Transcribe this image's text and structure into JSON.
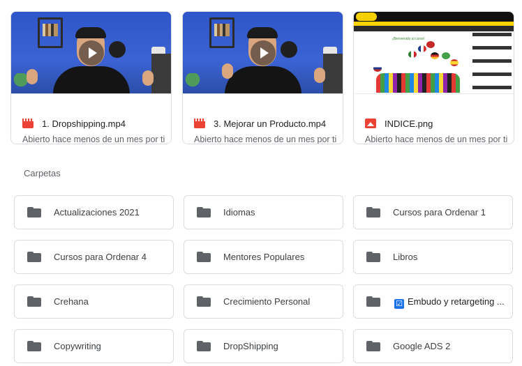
{
  "files": [
    {
      "name": "1. Dropshipping.mp4",
      "subtitle": "Abierto hace menos de un mes por ti",
      "type": "video",
      "icon": "video-file-icon"
    },
    {
      "name": "3. Mejorar un Producto.mp4",
      "subtitle": "Abierto hace menos de un mes por ti",
      "type": "video",
      "icon": "video-file-icon"
    },
    {
      "name": "INDICE.png",
      "subtitle": "Abierto hace menos de un mes por ti",
      "type": "image",
      "icon": "image-file-icon"
    }
  ],
  "folders_section": {
    "title": "Carpetas",
    "folders": [
      {
        "name": "Actualizaciones 2021"
      },
      {
        "name": "Idiomas"
      },
      {
        "name": "Cursos para Ordenar 1"
      },
      {
        "name": "Cursos para Ordenar 4"
      },
      {
        "name": "Mentores Populares"
      },
      {
        "name": "Libros"
      },
      {
        "name": "Crehana"
      },
      {
        "name": "Crecimiento Personal"
      },
      {
        "name": "Embudo y retargeting ...",
        "emoji": "☑"
      },
      {
        "name": "Copywriting"
      },
      {
        "name": "DropShipping"
      },
      {
        "name": "Google ADS 2"
      }
    ]
  },
  "thumbnail_texts": {
    "web_title": "¡Bienvenido al curso!"
  },
  "colors": {
    "video_icon": "#ea4335",
    "image_icon": "#ea4335",
    "folder_icon": "#5f6368",
    "checkbox": "#1a73e8"
  }
}
